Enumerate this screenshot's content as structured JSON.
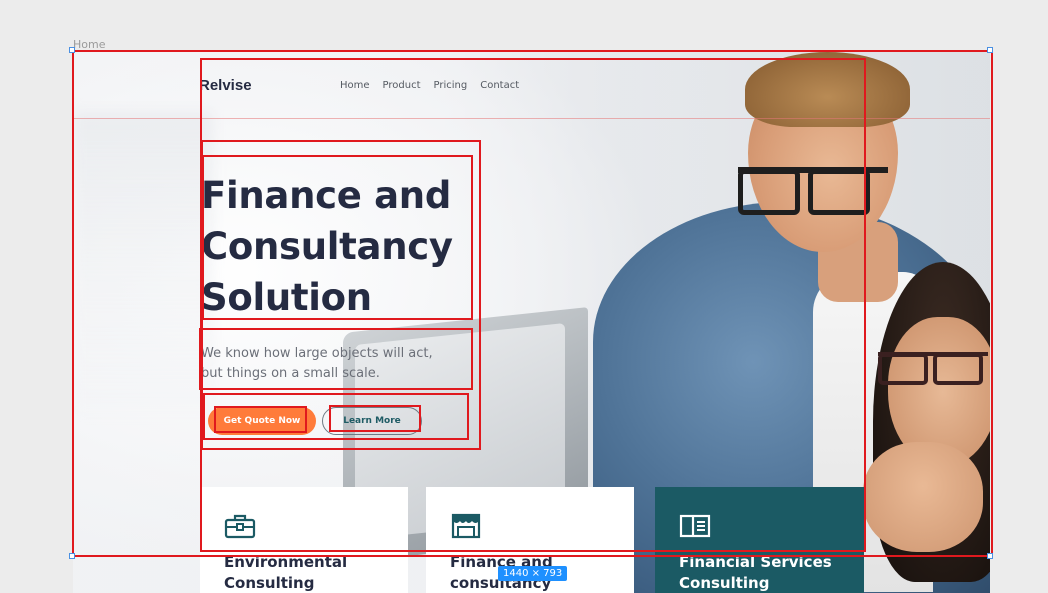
{
  "frame": {
    "label": "Home",
    "size_badge": "1440 × 793"
  },
  "header": {
    "logo": "Relvise",
    "nav": [
      "Home",
      "Product",
      "Pricing",
      "Contact"
    ]
  },
  "hero": {
    "title_lines": [
      "Finance and",
      "Consultancy",
      "Solution"
    ],
    "subtitle_lines": [
      "We know how large objects will act,",
      "but things on a small scale."
    ],
    "primary_button": "Get Quote Now",
    "secondary_button": "Learn More"
  },
  "cards": [
    {
      "icon": "briefcase-icon",
      "title_lines": [
        "Environmental",
        "Consulting"
      ]
    },
    {
      "icon": "storefront-icon",
      "title_lines": [
        "Finance and",
        "consultancy"
      ]
    },
    {
      "icon": "book-open-icon",
      "title_lines": [
        "Financial Services",
        "Consulting"
      ]
    }
  ],
  "colors": {
    "brand_dark": "#252b42",
    "accent_orange": "#ff7b3a",
    "teal": "#1b5a64",
    "selection_red": "#e0191e",
    "badge_blue": "#1e90ff"
  }
}
